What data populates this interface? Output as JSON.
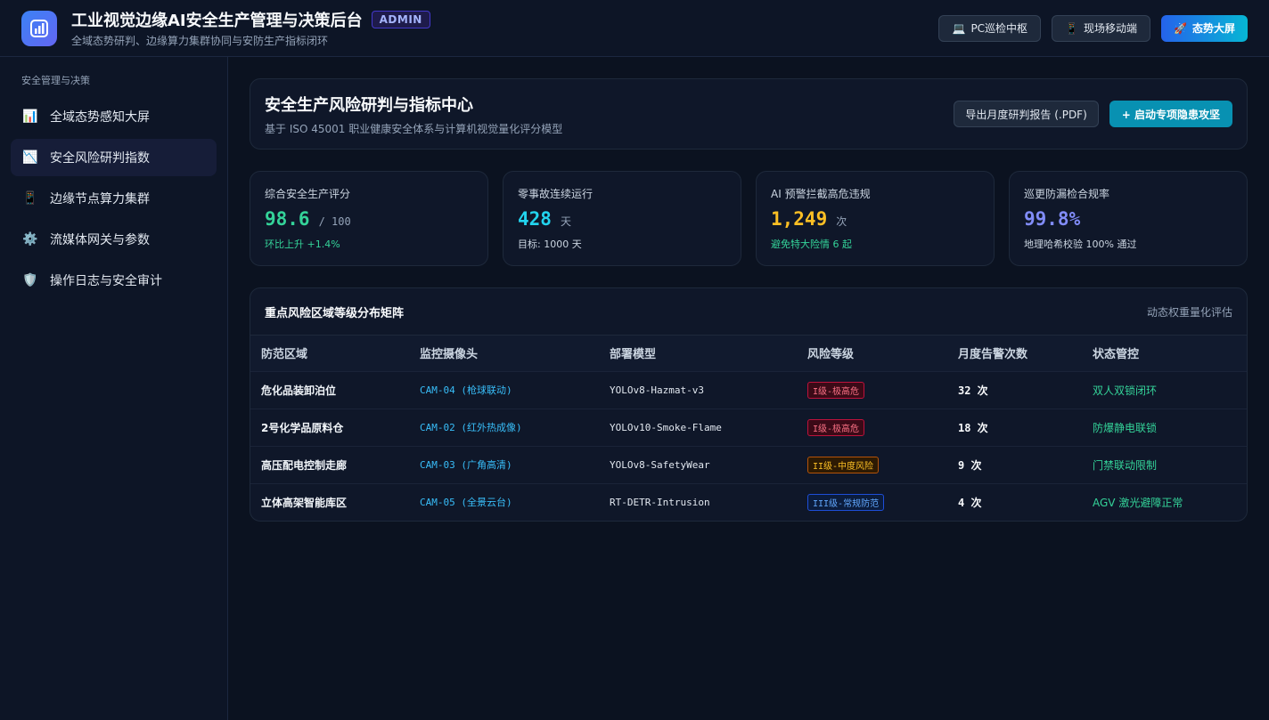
{
  "header": {
    "title": "工业视觉边缘AI安全生产管理与决策后台",
    "badge": "ADMIN",
    "subtitle": "全域态势研判、边缘算力集群协同与安防生产指标闭环",
    "buttons": [
      {
        "icon": "laptop-icon",
        "label": "PC巡检中枢"
      },
      {
        "icon": "mobile-icon",
        "label": "现场移动端"
      },
      {
        "icon": "rocket-icon",
        "label": "态势大屏"
      }
    ]
  },
  "sidebar": {
    "section": "安全管理与决策",
    "items": [
      {
        "icon": "bar-chart-icon",
        "label": "全域态势感知大屏"
      },
      {
        "icon": "trend-down-icon",
        "label": "安全风险研判指数"
      },
      {
        "icon": "device-icon",
        "label": "边缘节点算力集群"
      },
      {
        "icon": "gear-icon",
        "label": "流媒体网关与参数"
      },
      {
        "icon": "shield-icon",
        "label": "操作日志与安全审计"
      }
    ]
  },
  "panel": {
    "title": "安全生产风险研判与指标中心",
    "subtitle": "基于 ISO 45001 职业健康安全体系与计算机视觉量化评分模型",
    "export_label": "导出月度研判报告 (.PDF)",
    "launch_label": "+ 启动专项隐患攻坚"
  },
  "kpis": [
    {
      "label": "综合安全生产评分",
      "value": "98.6",
      "unit": "/ 100",
      "note": "环比上升 +1.4%",
      "color": "#34d399",
      "note_color": "#34d399"
    },
    {
      "label": "零事故连续运行",
      "value": "428",
      "unit": "天",
      "note": "目标: 1000 天",
      "color": "#22d3ee",
      "note_color": "#cbd5e1"
    },
    {
      "label": "AI 预警拦截高危违规",
      "value": "1,249",
      "unit": "次",
      "note": "避免特大险情 6 起",
      "color": "#fbbf24",
      "note_color": "#34d399"
    },
    {
      "label": "巡更防漏检合规率",
      "value": "99.8%",
      "unit": "",
      "note": "地理哈希校验 100% 通过",
      "color": "#818cf8",
      "note_color": "#cbd5e1"
    }
  ],
  "matrix": {
    "title": "重点风险区域等级分布矩阵",
    "tag": "动态权重量化评估",
    "columns": [
      "防范区域",
      "监控摄像头",
      "部署模型",
      "风险等级",
      "月度告警次数",
      "状态管控"
    ],
    "rows": [
      {
        "zone": "危化品装卸泊位",
        "camera": "CAM-04 (枪球联动)",
        "model": "YOLOv8-Hazmat-v3",
        "risk": "I级-极高危",
        "level": "r1",
        "count": "32 次",
        "control": "双人双锁闭环"
      },
      {
        "zone": "2号化学品原料仓",
        "camera": "CAM-02 (红外热成像)",
        "model": "YOLOv10-Smoke-Flame",
        "risk": "I级-极高危",
        "level": "r1",
        "count": "18 次",
        "control": "防爆静电联锁"
      },
      {
        "zone": "高压配电控制走廊",
        "camera": "CAM-03 (广角高清)",
        "model": "YOLOv8-SafetyWear",
        "risk": "II级-中度风险",
        "level": "r2",
        "count": "9 次",
        "control": "门禁联动限制"
      },
      {
        "zone": "立体高架智能库区",
        "camera": "CAM-05 (全景云台)",
        "model": "RT-DETR-Intrusion",
        "risk": "III级-常规防范",
        "level": "r3",
        "count": "4 次",
        "control": "AGV 激光避障正常"
      }
    ]
  }
}
